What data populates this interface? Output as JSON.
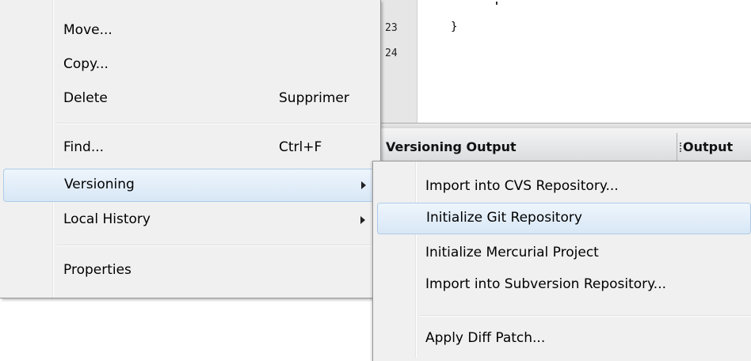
{
  "editor": {
    "line_numbers": [
      "23",
      "24"
    ],
    "code_line_23": "}"
  },
  "output_panel": {
    "tabs": [
      {
        "label": "Versioning Output"
      },
      {
        "label": "Output"
      }
    ]
  },
  "context_menu": {
    "items": [
      {
        "label": "Move...",
        "accelerator": ""
      },
      {
        "label": "Copy...",
        "accelerator": ""
      },
      {
        "label": "Delete",
        "accelerator": "Supprimer"
      },
      {
        "label": "Find...",
        "accelerator": "Ctrl+F"
      },
      {
        "label": "Versioning",
        "accelerator": ""
      },
      {
        "label": "Local History",
        "accelerator": ""
      },
      {
        "label": "Properties",
        "accelerator": ""
      }
    ]
  },
  "versioning_submenu": {
    "items": [
      {
        "label": "Import into CVS Repository..."
      },
      {
        "label": "Initialize Git Repository"
      },
      {
        "label": "Initialize Mercurial Project"
      },
      {
        "label": "Import into Subversion Repository..."
      },
      {
        "label": "Apply Diff Patch..."
      }
    ]
  }
}
